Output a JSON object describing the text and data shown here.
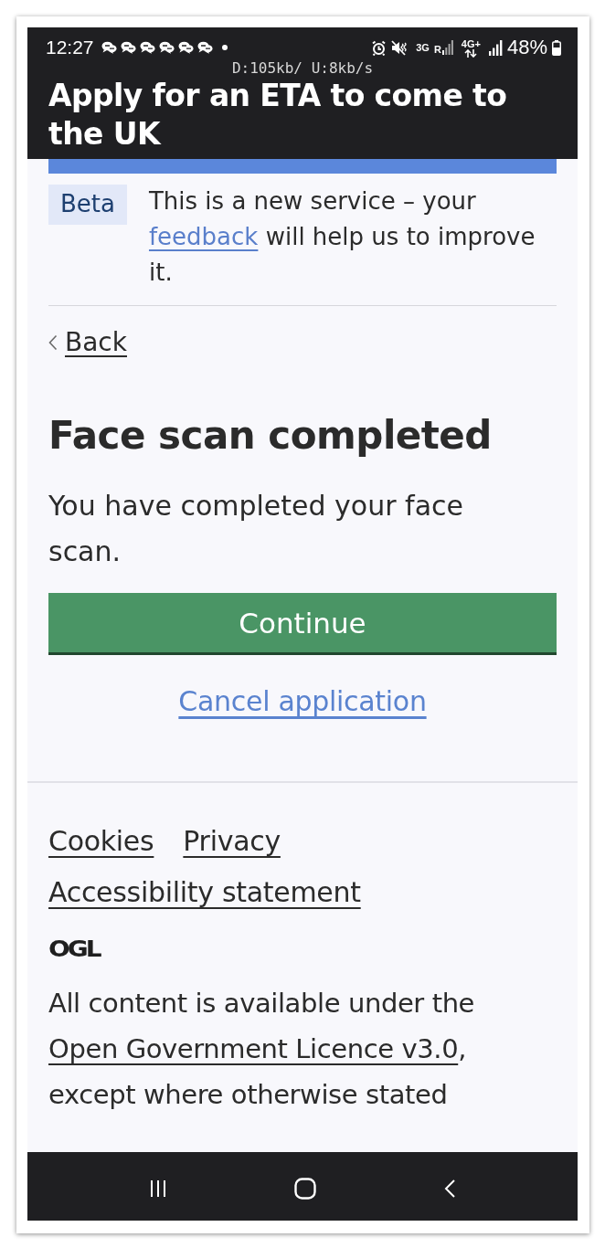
{
  "status_bar": {
    "time": "12:27",
    "notifications": [
      {
        "kind": "chat"
      },
      {
        "kind": "chat"
      },
      {
        "kind": "chat"
      },
      {
        "kind": "chat"
      },
      {
        "kind": "chat"
      },
      {
        "kind": "chat"
      }
    ],
    "network_1": "3G",
    "roaming": "R",
    "network_2": "4G+",
    "battery": "48%",
    "speed": "D:105kb/ U:8kb/s"
  },
  "header": {
    "title": "Apply for an ETA to come to the UK"
  },
  "phase_banner": {
    "tag": "Beta",
    "text_before": "This is a new service – your",
    "link": "feedback",
    "text_after": "will help us to improve it."
  },
  "back_link": "Back",
  "heading": "Face scan completed",
  "body": "You have completed your face scan.",
  "primary_button": "Continue",
  "cancel_link": "Cancel application",
  "footer": {
    "links": [
      "Cookies",
      "Privacy",
      "Accessibility statement"
    ],
    "licence_logo": "OGL",
    "licence_before": "All content is available under the",
    "licence_link": "Open Government Licence v3.0",
    "licence_after": ", except where otherwise stated"
  }
}
